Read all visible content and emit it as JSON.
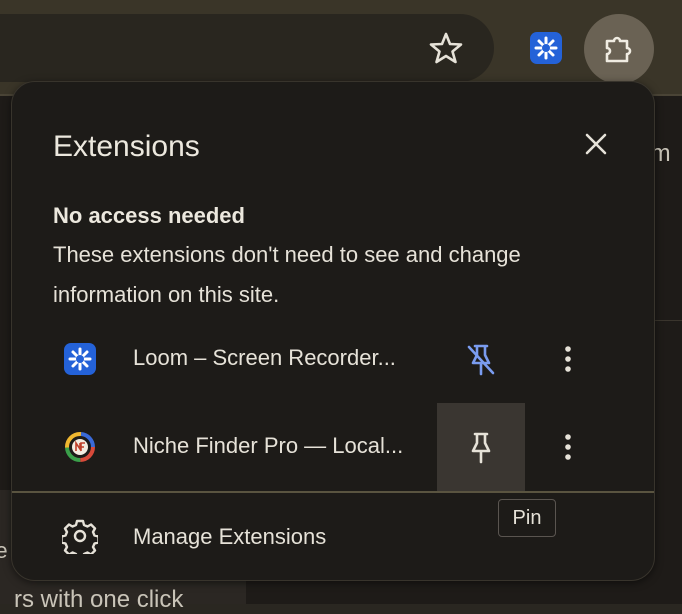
{
  "background": {
    "right_text": "r m",
    "left_text": "re",
    "bottom_text": "rs with one click"
  },
  "toolbar": {
    "bookmark_icon": "star-icon",
    "loom_toolbar_icon": "loom-icon",
    "extensions_icon": "puzzle-icon"
  },
  "popup": {
    "title": "Extensions",
    "close_icon": "close-icon",
    "section_heading": "No access needed",
    "section_desc": "These extensions don't need to see and change information on this site.",
    "extensions": [
      {
        "name": "Loom – Screen Recorder...",
        "icon": "loom-icon",
        "pinned": true,
        "pin_icon": "unpin-icon",
        "menu_icon": "more-vert-icon"
      },
      {
        "name": "Niche Finder Pro — Local...",
        "icon": "niche-finder-icon",
        "pinned": false,
        "pin_icon": "pin-icon",
        "menu_icon": "more-vert-icon"
      }
    ],
    "manage_label": "Manage Extensions",
    "manage_icon": "gear-icon"
  },
  "tooltip": {
    "text": "Pin"
  },
  "colors": {
    "accent_blue": "#7a9cf0",
    "loom_blue": "#2462d8",
    "popup_bg": "#1d1b18"
  }
}
